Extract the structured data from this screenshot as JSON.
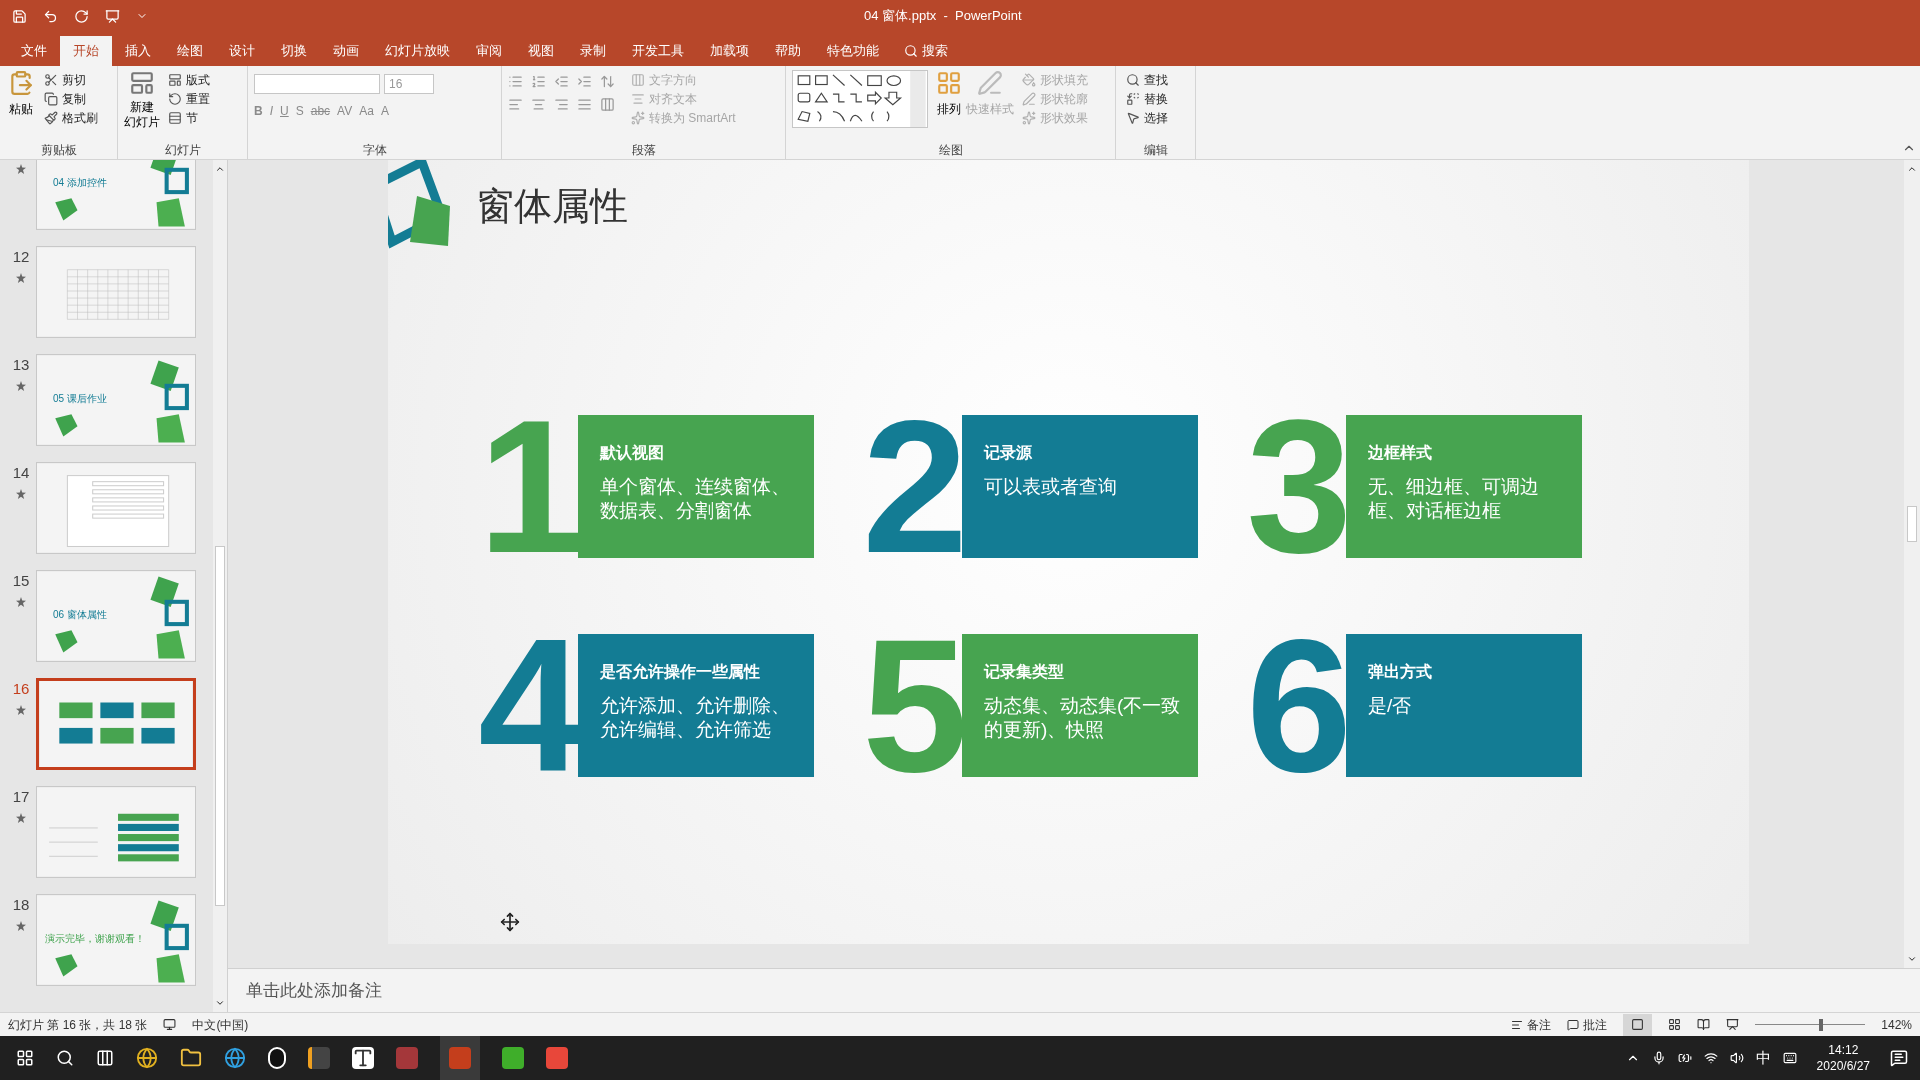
{
  "window": {
    "title": "04 窗体.pptx  -  PowerPoint"
  },
  "ribbon_tabs": [
    {
      "label": "文件",
      "selected": false
    },
    {
      "label": "开始",
      "selected": true
    },
    {
      "label": "插入",
      "selected": false
    },
    {
      "label": "绘图",
      "selected": false
    },
    {
      "label": "设计",
      "selected": false
    },
    {
      "label": "切换",
      "selected": false
    },
    {
      "label": "动画",
      "selected": false
    },
    {
      "label": "幻灯片放映",
      "selected": false
    },
    {
      "label": "审阅",
      "selected": false
    },
    {
      "label": "视图",
      "selected": false
    },
    {
      "label": "录制",
      "selected": false
    },
    {
      "label": "开发工具",
      "selected": false
    },
    {
      "label": "加载项",
      "selected": false
    },
    {
      "label": "帮助",
      "selected": false
    },
    {
      "label": "特色功能",
      "selected": false
    }
  ],
  "tell_me": {
    "label": "搜索"
  },
  "ribbon": {
    "clipboard": {
      "label": "剪贴板",
      "paste": "粘贴",
      "items": [
        {
          "label": "剪切",
          "disabled": false
        },
        {
          "label": "复制",
          "disabled": false
        },
        {
          "label": "格式刷",
          "disabled": false
        }
      ]
    },
    "slides": {
      "label": "幻灯片",
      "new_slide": [
        "新建",
        "幻灯片"
      ],
      "items": [
        {
          "label": "版式",
          "disabled": false
        },
        {
          "label": "重置",
          "disabled": false
        },
        {
          "label": "节",
          "disabled": false
        }
      ]
    },
    "font": {
      "label": "字体",
      "font_size": "16",
      "buttons": [
        "B",
        "I",
        "U",
        "S",
        "abc",
        "AV",
        "Aa",
        "A"
      ]
    },
    "paragraph": {
      "label": "段落",
      "items": [
        {
          "label": "文字方向",
          "disabled": true
        },
        {
          "label": "对齐文本",
          "disabled": true
        },
        {
          "label": "转换为 SmartArt",
          "disabled": true
        }
      ]
    },
    "drawing": {
      "label": "绘图",
      "arrange": "排列",
      "quick_styles": "快速样式",
      "items": [
        {
          "label": "形状填充",
          "disabled": true
        },
        {
          "label": "形状轮廓",
          "disabled": true
        },
        {
          "label": "形状效果",
          "disabled": true
        }
      ]
    },
    "editing": {
      "label": "编辑",
      "items": [
        {
          "label": "查找",
          "disabled": false
        },
        {
          "label": "替换",
          "disabled": false
        },
        {
          "label": "选择",
          "disabled": false
        }
      ]
    }
  },
  "thumbnails": [
    {
      "kind": "section",
      "title": "04 添加控件",
      "selected": false
    },
    {
      "number": "12",
      "kind": "table",
      "selected": false
    },
    {
      "number": "13",
      "kind": "section",
      "title": "05 课后作业",
      "selected": false
    },
    {
      "number": "14",
      "kind": "form",
      "selected": false
    },
    {
      "number": "15",
      "kind": "section",
      "title": "06 窗体属性",
      "selected": false
    },
    {
      "number": "16",
      "kind": "cards",
      "selected": true
    },
    {
      "number": "17",
      "kind": "list",
      "selected": false
    },
    {
      "number": "18",
      "kind": "end",
      "title": "演示完毕，谢谢观看！",
      "selected": false
    }
  ],
  "slide": {
    "title": "窗体属性",
    "cards": [
      {
        "number": "1",
        "heading": "默认视图",
        "body": "单个窗体、连续窗体、数据表、分割窗体",
        "color": "#47a450"
      },
      {
        "number": "2",
        "heading": "记录源",
        "body": "可以表或者查询",
        "color": "#137c94"
      },
      {
        "number": "3",
        "heading": "边框样式",
        "body": "无、细边框、可调边框、对话框边框",
        "color": "#47a450"
      },
      {
        "number": "4",
        "heading": "是否允许操作一些属性",
        "body": "允许添加、允许删除、允许编辑、允许筛选",
        "color": "#137c94"
      },
      {
        "number": "5",
        "heading": "记录集类型",
        "body": "动态集、动态集(不一致的更新)、快照",
        "color": "#47a450"
      },
      {
        "number": "6",
        "heading": "弹出方式",
        "body": "是/否",
        "color": "#137c94"
      }
    ]
  },
  "notes": {
    "placeholder": "单击此处添加备注"
  },
  "status_bar": {
    "slide_info": "幻灯片 第 16 张，共 18 张",
    "language": "中文(中国)",
    "notes": "备注",
    "comments": "批注",
    "zoom": "142%",
    "level": 0.58
  },
  "taskbar": {
    "ime": "中",
    "time": "14:12",
    "date": "2020/6/27"
  }
}
